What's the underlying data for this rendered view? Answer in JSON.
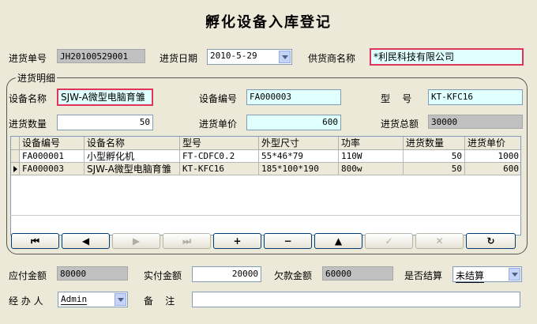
{
  "title": "孵化设备入库登记",
  "header": {
    "order_no_label": "进货单号",
    "order_no": "JH20100529001",
    "date_label": "进货日期",
    "date": "2010-5-29",
    "supplier_label": "供货商名称",
    "supplier": "*利民科技有限公司"
  },
  "detail": {
    "group_title": "进货明细",
    "device_name_label": "设备名称",
    "device_name": "SJW-A微型电脑育雏",
    "device_no_label": "设备编号",
    "device_no": "FA000003",
    "model_label": "型    号",
    "model": "KT-KFC16",
    "qty_label": "进货数量",
    "qty": "50",
    "unit_price_label": "进货单价",
    "unit_price": "600",
    "total_label": "进货总额",
    "total": "30000"
  },
  "grid": {
    "columns": [
      "设备编号",
      "设备名称",
      "型号",
      "外型尺寸",
      "功率",
      "进货数量",
      "进货单价"
    ],
    "rows": [
      [
        "FA000001",
        "小型孵化机",
        "FT-CDFC0.2",
        "55*46*79",
        "110W",
        "50",
        "1000"
      ],
      [
        "FA000003",
        "SJW-A微型电脑育雏",
        "KT-KFC16",
        "185*100*190",
        "800w",
        "50",
        "600"
      ]
    ]
  },
  "nav": {
    "first": "⏮",
    "prev": "◀",
    "next": "▶",
    "last": "⏭",
    "add": "+",
    "delete": "−",
    "edit": "▲",
    "post": "✓",
    "cancel": "✕",
    "refresh": "↻"
  },
  "footer": {
    "payable_label": "应付金额",
    "payable": "80000",
    "paid_label": "实付金额",
    "paid": "20000",
    "owed_label": "欠款金额",
    "owed": "60000",
    "settled_label": "是否结算",
    "settled": "未结算",
    "handler_label": "经 办 人",
    "handler": "Admin",
    "remark_label": "备    注",
    "remark": ""
  },
  "colors": {
    "focus_border": "#e0345a",
    "cyan_field": "#e0ffff",
    "readonly": "#c0c0c0"
  }
}
